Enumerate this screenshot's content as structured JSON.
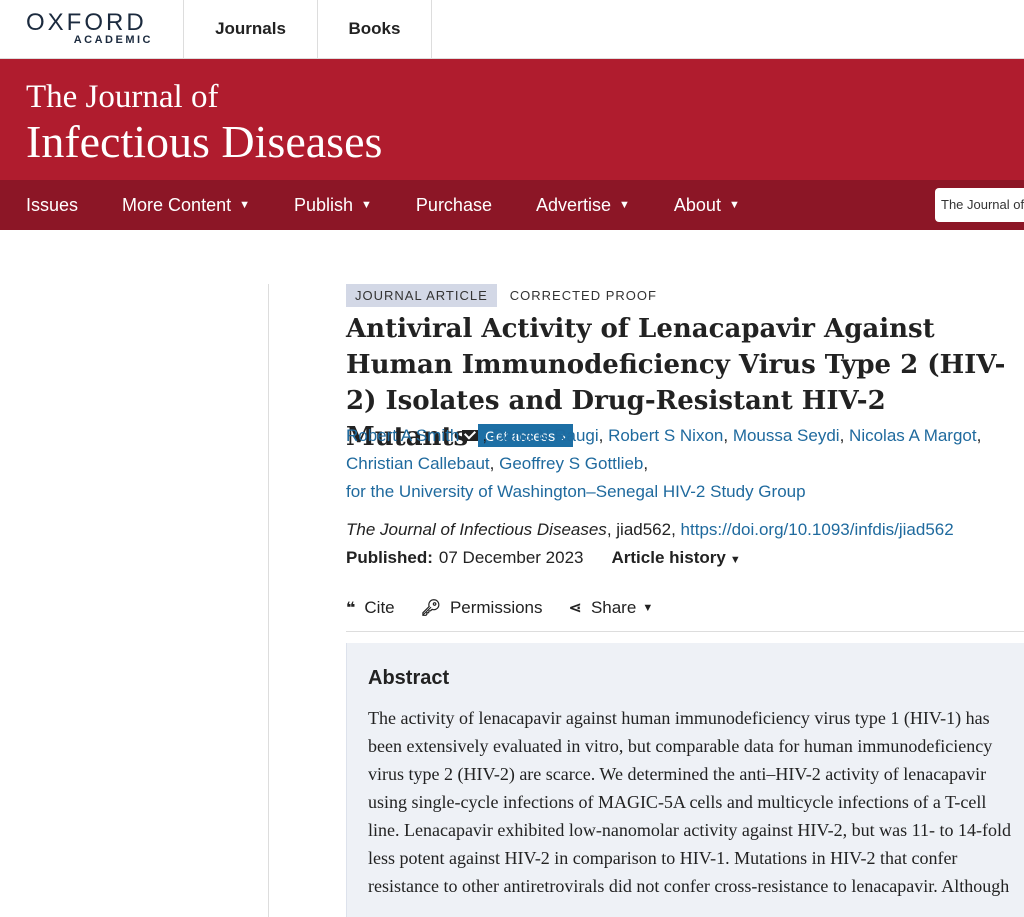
{
  "topbar": {
    "logo_main": "OXFORD",
    "logo_sub": "ACADEMIC",
    "nav": [
      "Journals",
      "Books"
    ]
  },
  "banner": {
    "line1": "The Journal of",
    "line2": "Infectious Diseases"
  },
  "mainnav": {
    "items": [
      {
        "label": "Issues",
        "dropdown": false
      },
      {
        "label": "More Content",
        "dropdown": true
      },
      {
        "label": "Publish",
        "dropdown": true
      },
      {
        "label": "Purchase",
        "dropdown": false
      },
      {
        "label": "Advertise",
        "dropdown": true
      },
      {
        "label": "About",
        "dropdown": true
      }
    ],
    "search_text": "The Journal of I"
  },
  "article": {
    "type_badge": "JOURNAL ARTICLE",
    "proof_badge": "CORRECTED PROOF",
    "title": "Antiviral Activity of Lenacapavir Against Human Immunodeficiency Virus Type 2 (HIV-2) Isolates and Drug-Resistant HIV-2 Mutants",
    "get_access": "Get access",
    "authors": [
      "Robert A Smith",
      "Dana N Raugi",
      "Robert S Nixon",
      "Moussa Seydi",
      "Nicolas A Margot",
      "Christian Callebaut",
      "Geoffrey S Gottlieb"
    ],
    "group": "for the University of Washington–Senegal HIV-2 Study Group",
    "journal": "The Journal of Infectious Diseases",
    "article_id": ", jiad562, ",
    "doi": "https://doi.org/10.1093/infdis/jiad562",
    "published_label": "Published:",
    "published_date": "07 December 2023",
    "history_label": "Article history"
  },
  "tools": {
    "cite": "Cite",
    "permissions": "Permissions",
    "share": "Share"
  },
  "abstract": {
    "heading": "Abstract",
    "text": "The activity of lenacapavir against human immunodeficiency virus type 1 (HIV-1) has been extensively evaluated in vitro, but comparable data for human immunodeficiency virus type 2 (HIV-2) are scarce. We determined the anti–HIV-2 activity of lenacapavir using single-cycle infections of MAGIC-5A cells and multicycle infections of a T-cell line. Lenacapavir exhibited low-nanomolar activity against HIV-2, but was 11- to 14-fold less potent against HIV-2 in comparison to HIV-1. Mutations in HIV-2 that confer resistance to other antiretrovirals did not confer cross-resistance to lenacapavir. Although"
  }
}
